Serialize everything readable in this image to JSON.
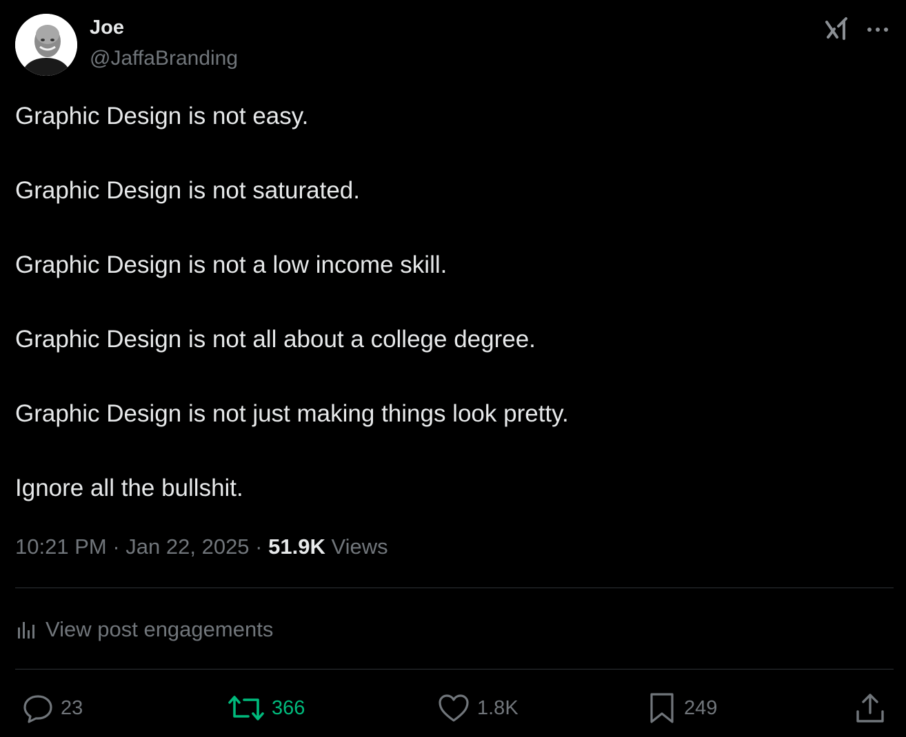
{
  "author": {
    "name": "Joe",
    "handle": "@JaffaBranding"
  },
  "post": {
    "lines": [
      "Graphic Design is not easy.",
      "Graphic Design is not saturated.",
      "Graphic Design is not a low income skill.",
      "Graphic Design is not all about a college degree.",
      "Graphic Design is not just making things look pretty.",
      "Ignore all the bullshit."
    ]
  },
  "meta": {
    "time": "10:21 PM",
    "separator": "·",
    "date": "Jan 22, 2025",
    "views_count": "51.9K",
    "views_label": "Views"
  },
  "engagements": {
    "label": "View post engagements",
    "icon": "analytics-icon"
  },
  "actions": {
    "replies": "23",
    "reposts": "366",
    "likes": "1.8K",
    "bookmarks": "249"
  },
  "colors": {
    "background": "#000000",
    "text": "#e7e9ea",
    "secondary": "#71767b",
    "repost_active": "#00ba7c",
    "divider": "#2f3336"
  }
}
